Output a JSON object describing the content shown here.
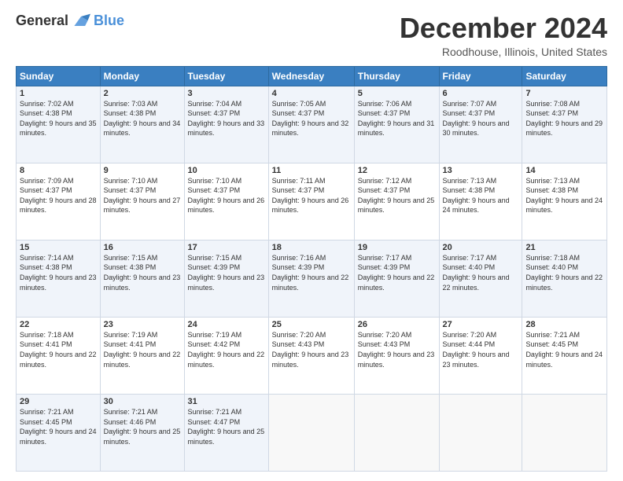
{
  "logo": {
    "general": "General",
    "blue": "Blue"
  },
  "header": {
    "month": "December 2024",
    "location": "Roodhouse, Illinois, United States"
  },
  "weekdays": [
    "Sunday",
    "Monday",
    "Tuesday",
    "Wednesday",
    "Thursday",
    "Friday",
    "Saturday"
  ],
  "weeks": [
    [
      {
        "day": "1",
        "sunrise": "7:02 AM",
        "sunset": "4:38 PM",
        "daylight": "9 hours and 35 minutes."
      },
      {
        "day": "2",
        "sunrise": "7:03 AM",
        "sunset": "4:38 PM",
        "daylight": "9 hours and 34 minutes."
      },
      {
        "day": "3",
        "sunrise": "7:04 AM",
        "sunset": "4:37 PM",
        "daylight": "9 hours and 33 minutes."
      },
      {
        "day": "4",
        "sunrise": "7:05 AM",
        "sunset": "4:37 PM",
        "daylight": "9 hours and 32 minutes."
      },
      {
        "day": "5",
        "sunrise": "7:06 AM",
        "sunset": "4:37 PM",
        "daylight": "9 hours and 31 minutes."
      },
      {
        "day": "6",
        "sunrise": "7:07 AM",
        "sunset": "4:37 PM",
        "daylight": "9 hours and 30 minutes."
      },
      {
        "day": "7",
        "sunrise": "7:08 AM",
        "sunset": "4:37 PM",
        "daylight": "9 hours and 29 minutes."
      }
    ],
    [
      {
        "day": "8",
        "sunrise": "7:09 AM",
        "sunset": "4:37 PM",
        "daylight": "9 hours and 28 minutes."
      },
      {
        "day": "9",
        "sunrise": "7:10 AM",
        "sunset": "4:37 PM",
        "daylight": "9 hours and 27 minutes."
      },
      {
        "day": "10",
        "sunrise": "7:10 AM",
        "sunset": "4:37 PM",
        "daylight": "9 hours and 26 minutes."
      },
      {
        "day": "11",
        "sunrise": "7:11 AM",
        "sunset": "4:37 PM",
        "daylight": "9 hours and 26 minutes."
      },
      {
        "day": "12",
        "sunrise": "7:12 AM",
        "sunset": "4:37 PM",
        "daylight": "9 hours and 25 minutes."
      },
      {
        "day": "13",
        "sunrise": "7:13 AM",
        "sunset": "4:38 PM",
        "daylight": "9 hours and 24 minutes."
      },
      {
        "day": "14",
        "sunrise": "7:13 AM",
        "sunset": "4:38 PM",
        "daylight": "9 hours and 24 minutes."
      }
    ],
    [
      {
        "day": "15",
        "sunrise": "7:14 AM",
        "sunset": "4:38 PM",
        "daylight": "9 hours and 23 minutes."
      },
      {
        "day": "16",
        "sunrise": "7:15 AM",
        "sunset": "4:38 PM",
        "daylight": "9 hours and 23 minutes."
      },
      {
        "day": "17",
        "sunrise": "7:15 AM",
        "sunset": "4:39 PM",
        "daylight": "9 hours and 23 minutes."
      },
      {
        "day": "18",
        "sunrise": "7:16 AM",
        "sunset": "4:39 PM",
        "daylight": "9 hours and 22 minutes."
      },
      {
        "day": "19",
        "sunrise": "7:17 AM",
        "sunset": "4:39 PM",
        "daylight": "9 hours and 22 minutes."
      },
      {
        "day": "20",
        "sunrise": "7:17 AM",
        "sunset": "4:40 PM",
        "daylight": "9 hours and 22 minutes."
      },
      {
        "day": "21",
        "sunrise": "7:18 AM",
        "sunset": "4:40 PM",
        "daylight": "9 hours and 22 minutes."
      }
    ],
    [
      {
        "day": "22",
        "sunrise": "7:18 AM",
        "sunset": "4:41 PM",
        "daylight": "9 hours and 22 minutes."
      },
      {
        "day": "23",
        "sunrise": "7:19 AM",
        "sunset": "4:41 PM",
        "daylight": "9 hours and 22 minutes."
      },
      {
        "day": "24",
        "sunrise": "7:19 AM",
        "sunset": "4:42 PM",
        "daylight": "9 hours and 22 minutes."
      },
      {
        "day": "25",
        "sunrise": "7:20 AM",
        "sunset": "4:43 PM",
        "daylight": "9 hours and 23 minutes."
      },
      {
        "day": "26",
        "sunrise": "7:20 AM",
        "sunset": "4:43 PM",
        "daylight": "9 hours and 23 minutes."
      },
      {
        "day": "27",
        "sunrise": "7:20 AM",
        "sunset": "4:44 PM",
        "daylight": "9 hours and 23 minutes."
      },
      {
        "day": "28",
        "sunrise": "7:21 AM",
        "sunset": "4:45 PM",
        "daylight": "9 hours and 24 minutes."
      }
    ],
    [
      {
        "day": "29",
        "sunrise": "7:21 AM",
        "sunset": "4:45 PM",
        "daylight": "9 hours and 24 minutes."
      },
      {
        "day": "30",
        "sunrise": "7:21 AM",
        "sunset": "4:46 PM",
        "daylight": "9 hours and 25 minutes."
      },
      {
        "day": "31",
        "sunrise": "7:21 AM",
        "sunset": "4:47 PM",
        "daylight": "9 hours and 25 minutes."
      },
      null,
      null,
      null,
      null
    ]
  ]
}
